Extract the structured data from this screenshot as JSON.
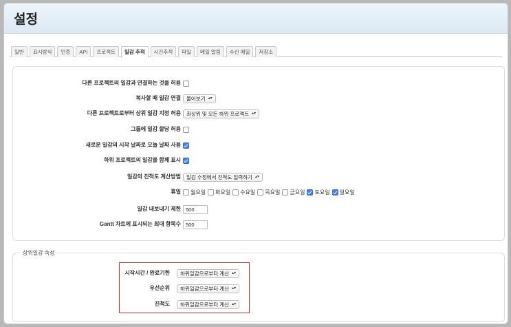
{
  "page_title": "설정",
  "tabs": [
    {
      "label": "일반"
    },
    {
      "label": "표시방식"
    },
    {
      "label": "인증"
    },
    {
      "label": "API"
    },
    {
      "label": "프로젝트"
    },
    {
      "label": "일감 추적"
    },
    {
      "label": "시간추적"
    },
    {
      "label": "파일"
    },
    {
      "label": "메일 알림"
    },
    {
      "label": "수신 메일"
    },
    {
      "label": "저장소"
    }
  ],
  "active_tab": "일감 추적",
  "settings": {
    "cross_project_relations": {
      "label": "다른 프로젝트의 일감과 연결하는 것을 허용",
      "checked": false
    },
    "copy_on_relation": {
      "label": "복사할 때 일감 연결",
      "value": "물어보기"
    },
    "cross_project_subtasks": {
      "label": "다른 프로젝트로부터 상위 일감 지정 허용",
      "value": "최상위 및 모든 하위 프로젝트"
    },
    "group_assignment": {
      "label": "그룹에 일감 할당 허용",
      "checked": false
    },
    "default_start_today": {
      "label": "새로운 일감의 시작 날짜로 오늘 날짜 사용",
      "checked": true
    },
    "display_subprojects": {
      "label": "하위 프로젝트의 일감을 함께 표시",
      "checked": true
    },
    "done_ratio": {
      "label": "일감의 진척도 계산방법",
      "value": "일감 수정에서 진척도 입력하기"
    },
    "non_working_days": {
      "label": "휴일",
      "days": [
        {
          "label": "월요일",
          "checked": false
        },
        {
          "label": "화요일",
          "checked": false
        },
        {
          "label": "수요일",
          "checked": false
        },
        {
          "label": "목요일",
          "checked": false
        },
        {
          "label": "금요일",
          "checked": false
        },
        {
          "label": "토요일",
          "checked": true
        },
        {
          "label": "일요일",
          "checked": true
        }
      ]
    },
    "export_limit": {
      "label": "일감 내보내기 제한",
      "value": "500"
    },
    "gantt_items_limit": {
      "label": "Gantt 차트에 표시되는 최대 항목수",
      "value": "500"
    }
  },
  "parent_attributes": {
    "legend": "상위일감 속성",
    "dates": {
      "label": "시작시간 / 완료기한",
      "value": "하위일감으로부터 계산"
    },
    "priority": {
      "label": "우선순위",
      "value": "하위일감으로부터 계산"
    },
    "done_ratio": {
      "label": "진척도",
      "value": "하위일감으로부터 계산"
    }
  },
  "colors": {
    "highlight_border": "#c0392b",
    "checkbox_checked": "#3b82f6",
    "header_bg": "#dce8f3"
  }
}
